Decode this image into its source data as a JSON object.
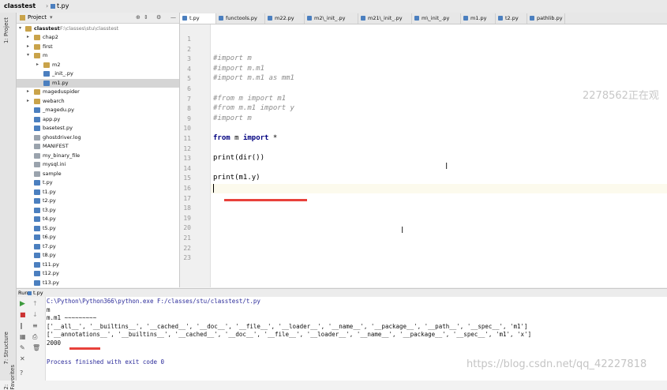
{
  "titlebar": {
    "project": "classtest",
    "file": "t.py"
  },
  "sidebar_labels": {
    "project": "1: Project",
    "structure": "7: Structure",
    "favorites": "2: Favorites"
  },
  "project_panel": {
    "header": "Project",
    "root": "classtest",
    "root_path": "F:\\classes\\stu\\classtest",
    "items": [
      {
        "label": "chap2",
        "type": "folder",
        "depth": 1,
        "arrow": "▸"
      },
      {
        "label": "first",
        "type": "folder",
        "depth": 1,
        "arrow": "▸"
      },
      {
        "label": "m",
        "type": "folder",
        "depth": 1,
        "arrow": "▾"
      },
      {
        "label": "m2",
        "type": "folder",
        "depth": 2,
        "arrow": "▸"
      },
      {
        "label": "_init_.py",
        "type": "py",
        "depth": 2,
        "arrow": ""
      },
      {
        "label": "m1.py",
        "type": "py",
        "depth": 2,
        "arrow": "",
        "selected": true
      },
      {
        "label": "mageduspider",
        "type": "folder",
        "depth": 1,
        "arrow": "▸"
      },
      {
        "label": "webarch",
        "type": "folder",
        "depth": 1,
        "arrow": "▸"
      },
      {
        "label": "_magedu.py",
        "type": "py",
        "depth": 1,
        "arrow": ""
      },
      {
        "label": "app.py",
        "type": "py",
        "depth": 1,
        "arrow": ""
      },
      {
        "label": "basetest.py",
        "type": "py",
        "depth": 1,
        "arrow": ""
      },
      {
        "label": "ghostdriver.log",
        "type": "txt",
        "depth": 1,
        "arrow": ""
      },
      {
        "label": "MANIFEST",
        "type": "txt",
        "depth": 1,
        "arrow": ""
      },
      {
        "label": "my_binary_file",
        "type": "txt",
        "depth": 1,
        "arrow": ""
      },
      {
        "label": "mysql.ini",
        "type": "txt",
        "depth": 1,
        "arrow": ""
      },
      {
        "label": "sample",
        "type": "txt",
        "depth": 1,
        "arrow": ""
      },
      {
        "label": "t.py",
        "type": "py",
        "depth": 1,
        "arrow": ""
      },
      {
        "label": "t1.py",
        "type": "py",
        "depth": 1,
        "arrow": ""
      },
      {
        "label": "t2.py",
        "type": "py",
        "depth": 1,
        "arrow": ""
      },
      {
        "label": "t3.py",
        "type": "py",
        "depth": 1,
        "arrow": ""
      },
      {
        "label": "t4.py",
        "type": "py",
        "depth": 1,
        "arrow": ""
      },
      {
        "label": "t5.py",
        "type": "py",
        "depth": 1,
        "arrow": ""
      },
      {
        "label": "t6.py",
        "type": "py",
        "depth": 1,
        "arrow": ""
      },
      {
        "label": "t7.py",
        "type": "py",
        "depth": 1,
        "arrow": ""
      },
      {
        "label": "t8.py",
        "type": "py",
        "depth": 1,
        "arrow": ""
      },
      {
        "label": "t11.py",
        "type": "py",
        "depth": 1,
        "arrow": ""
      },
      {
        "label": "t12.py",
        "type": "py",
        "depth": 1,
        "arrow": ""
      },
      {
        "label": "t13.py",
        "type": "py",
        "depth": 1,
        "arrow": ""
      }
    ]
  },
  "tabs": [
    "t.py",
    "functools.py",
    "m22.py",
    "m2\\_init_.py",
    "m21\\_init_.py",
    "m\\_init_.py",
    "m1.py",
    "t2.py",
    "pathlib.py"
  ],
  "active_tab": 0,
  "editor": {
    "line_numbers": [
      "1",
      "2",
      "3",
      "4",
      "5",
      "6",
      "7",
      "8",
      "9",
      "10",
      "11",
      "12",
      "13",
      "14",
      "15",
      "16",
      "17",
      "18",
      "19",
      "20",
      "21",
      "22",
      "23"
    ],
    "lines": [
      {
        "n": 3,
        "text": "#import m",
        "cls": "cmt"
      },
      {
        "n": 4,
        "text": "#import m.m1",
        "cls": "cmt"
      },
      {
        "n": 5,
        "text": "#import m.m1 as mm1",
        "cls": "cmt"
      },
      {
        "n": 7,
        "text": "#from m import m1",
        "cls": "cmt"
      },
      {
        "n": 8,
        "text": "#from m.m1 import y",
        "cls": "cmt"
      },
      {
        "n": 9,
        "text": "#import m",
        "cls": "cmt"
      },
      {
        "n": 11,
        "kw1": "from",
        "mid": " m ",
        "kw2": "import",
        "rest": " *"
      },
      {
        "n": 13,
        "text": "print(dir())",
        "cls": "fn"
      },
      {
        "n": 15,
        "text": "print(m1.y)",
        "cls": "fn"
      }
    ],
    "current_line": 16
  },
  "run": {
    "label": "Run",
    "run_icon": "run-icon"
  },
  "console": [
    "C:\\Python\\Python366\\python.exe F:/classes/stu/classtest/t.py",
    "m",
    "m.m1 ~~~~~~~~~",
    "['__all__', '__builtins__', '__cached__', '__doc__', '__file__', '__loader__', '__name__', '__package__', '__path__', '__spec__', 'm1']",
    "['__annotations__', '__builtins__', '__cached__', '__doc__', '__file__', '__loader__', '__name__', '__package__', '__spec__', 'm1', 'x']",
    "2000",
    "",
    "Process finished with exit code 0"
  ],
  "watermarks": {
    "overlay": "2278562正在观",
    "blog": "https://blog.csdn.net/qq_42227818"
  },
  "colors": {
    "accent_red": "#e8413b",
    "keyword": "#000080",
    "comment": "#8c8c8c",
    "selected_row": "#d5d5d5"
  }
}
